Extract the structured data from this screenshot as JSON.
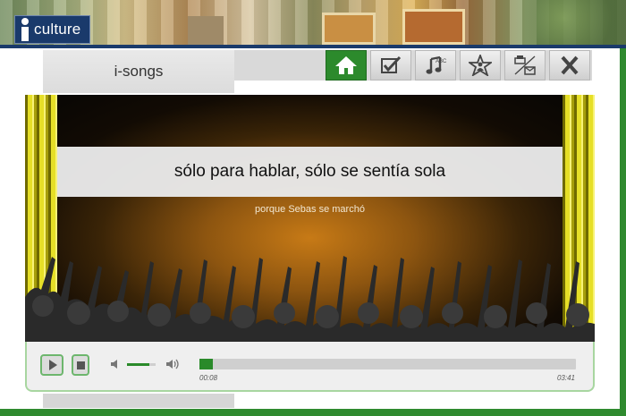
{
  "brand": {
    "logo_text": "culture",
    "logo_prefix": "i"
  },
  "app": {
    "title": "i-songs"
  },
  "toolbar": {
    "buttons": [
      {
        "name": "home-button",
        "icon": "home-icon",
        "active": true
      },
      {
        "name": "checklist-button",
        "icon": "checkbox-icon",
        "active": false
      },
      {
        "name": "music-lyrics-button",
        "icon": "music-abc-icon",
        "active": false
      },
      {
        "name": "favorite-button",
        "icon": "star-person-icon",
        "active": false
      },
      {
        "name": "print-email-button",
        "icon": "printer-envelope-icon",
        "active": false
      },
      {
        "name": "close-button",
        "icon": "close-icon",
        "active": false
      }
    ]
  },
  "lyrics": {
    "current_line": "sólo para hablar, sólo se sentía sola",
    "next_line": "porque Sebas se marchó"
  },
  "player": {
    "current_time": "00:08",
    "total_time": "03:41",
    "progress_fraction": 0.036,
    "volume_fraction": 0.78
  },
  "colors": {
    "accent_green": "#2c8a2c",
    "brand_navy": "#1a3a6b"
  }
}
